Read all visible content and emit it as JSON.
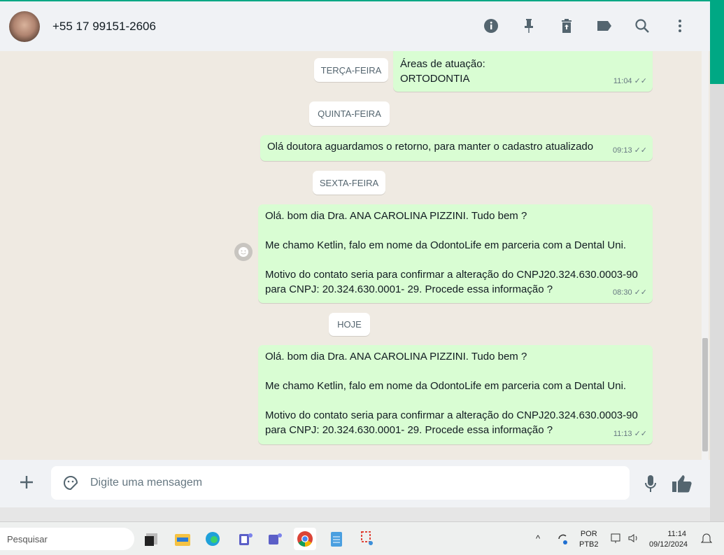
{
  "header": {
    "contact": "+55 17 99151-2606",
    "icons": [
      "info-icon",
      "pin-icon",
      "delete-icon",
      "label-icon",
      "search-icon",
      "menu-icon"
    ]
  },
  "dates": {
    "tue": "TERÇA-FEIRA",
    "thu": "QUINTA-FEIRA",
    "fri": "SEXTA-FEIRA",
    "today": "HOJE"
  },
  "messages": [
    {
      "text": "Áreas de atuação:\nORTODONTIA",
      "time": "11:04"
    },
    {
      "text": "Olá doutora aguardamos o retorno, para manter o cadastro atualizado",
      "time": "09:13"
    },
    {
      "text": "Olá. bom dia Dra. ANA CAROLINA PIZZINI. Tudo bem ?\n\nMe chamo Ketlin, falo em nome da OdontoLife em parceria com a Dental Uni.\n\nMotivo do contato seria para confirmar a alteração do CNPJ20.324.630.0003-90\npara CNPJ: 20.324.630.0001- 29. Procede essa informação ?",
      "time": "08:30"
    },
    {
      "text": "Olá. bom dia Dra. ANA CAROLINA PIZZINI. Tudo bem ?\n\nMe chamo Ketlin, falo em nome da OdontoLife em parceria com a Dental Uni.\n\nMotivo do contato seria para confirmar a alteração do CNPJ20.324.630.0003-90\npara CNPJ: 20.324.630.0001- 29. Procede essa informação ?",
      "time": "11:13"
    }
  ],
  "composer": {
    "placeholder": "Digite uma mensagem"
  },
  "taskbar": {
    "search": "Pesquisar",
    "lang1": "POR",
    "lang2": "PTB2",
    "time": "11:14",
    "date": "09/12/2024"
  },
  "colors": {
    "accent": "#00a884",
    "bubble": "#d9fdd3",
    "chat_bg": "#efeae2"
  }
}
